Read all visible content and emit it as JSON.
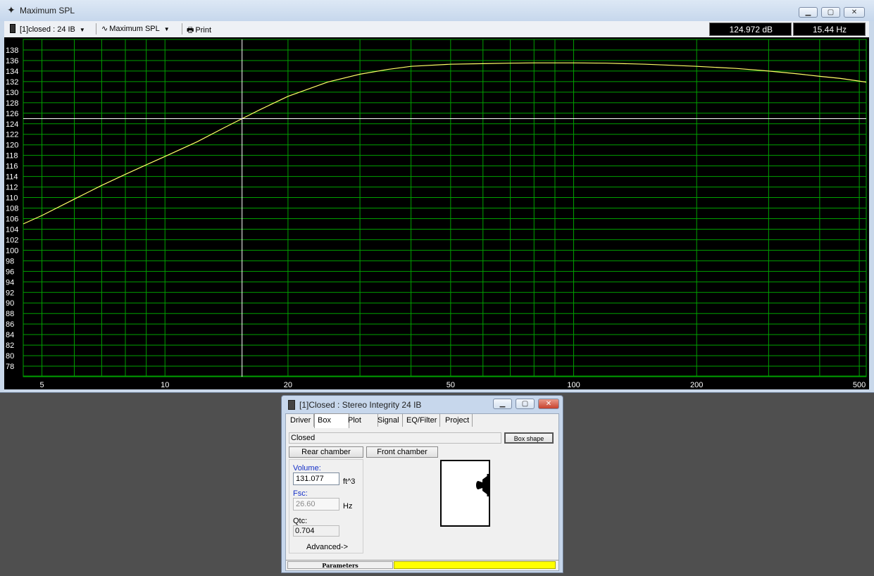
{
  "main_window": {
    "title": "Maximum SPL",
    "caption_buttons": {
      "minimize": "▁",
      "maximize": "▢",
      "close": "✕"
    }
  },
  "toolbar": {
    "project_selector": "[1]closed : 24 IB",
    "graph_selector": "Maximum SPL",
    "print_label": "Print",
    "readout_db": "124.972 dB",
    "readout_hz": "15.44 Hz"
  },
  "chart_data": {
    "type": "line",
    "x_scale": "log",
    "xlim": [
      4.5,
      520
    ],
    "ylim": [
      76,
      140
    ],
    "y_ticks": [
      78,
      80,
      82,
      84,
      86,
      88,
      90,
      92,
      94,
      96,
      98,
      100,
      102,
      104,
      106,
      108,
      110,
      112,
      114,
      116,
      118,
      120,
      122,
      124,
      126,
      128,
      130,
      132,
      134,
      136,
      138
    ],
    "x_tick_labels": [
      5,
      10,
      20,
      50,
      100,
      200,
      500
    ],
    "x_gridlines": [
      5,
      6,
      7,
      8,
      9,
      10,
      20,
      30,
      40,
      50,
      60,
      70,
      80,
      90,
      100,
      200,
      300,
      400,
      500
    ],
    "grid": true,
    "colors": {
      "background": "#000000",
      "grid": "#00a000",
      "curve": "#ffff66",
      "cursor": "#ffffff",
      "tick_text": "#ffffff"
    },
    "cursor": {
      "x": 15.44,
      "y": 124.972
    },
    "series": [
      {
        "x": [
          4.5,
          5,
          6,
          7,
          8,
          9,
          10,
          12,
          14,
          15.44,
          17,
          20,
          25,
          30,
          35,
          40,
          50,
          60,
          70,
          80,
          100,
          120,
          150,
          200,
          250,
          300,
          350,
          400,
          450,
          520
        ],
        "y": [
          105.0,
          106.6,
          109.7,
          112.3,
          114.4,
          116.2,
          117.8,
          120.6,
          123.3,
          124.97,
          126.6,
          129.2,
          131.9,
          133.4,
          134.3,
          134.9,
          135.3,
          135.4,
          135.5,
          135.55,
          135.55,
          135.5,
          135.3,
          134.9,
          134.5,
          134.0,
          133.5,
          133.0,
          132.6,
          131.9
        ]
      }
    ]
  },
  "dialog": {
    "title": "[1]Closed : Stereo Integrity 24 IB",
    "tabs": [
      "Driver",
      "Box",
      "Plot",
      "Signal",
      "EQ/Filter",
      "Project"
    ],
    "box_type": "Closed",
    "box_shape_button": "Box shape",
    "rear_chamber_button": "Rear chamber",
    "front_chamber_button": "Front chamber",
    "volume_label": "Volume:",
    "volume_value": "131.077",
    "volume_unit": "ft^3",
    "fsc_label": "Fsc:",
    "fsc_value": "26.60",
    "fsc_unit": "Hz",
    "qtc_label": "Qtc:",
    "qtc_value": "0.704",
    "advanced_button": "Advanced->",
    "status_label": "Parameters"
  }
}
